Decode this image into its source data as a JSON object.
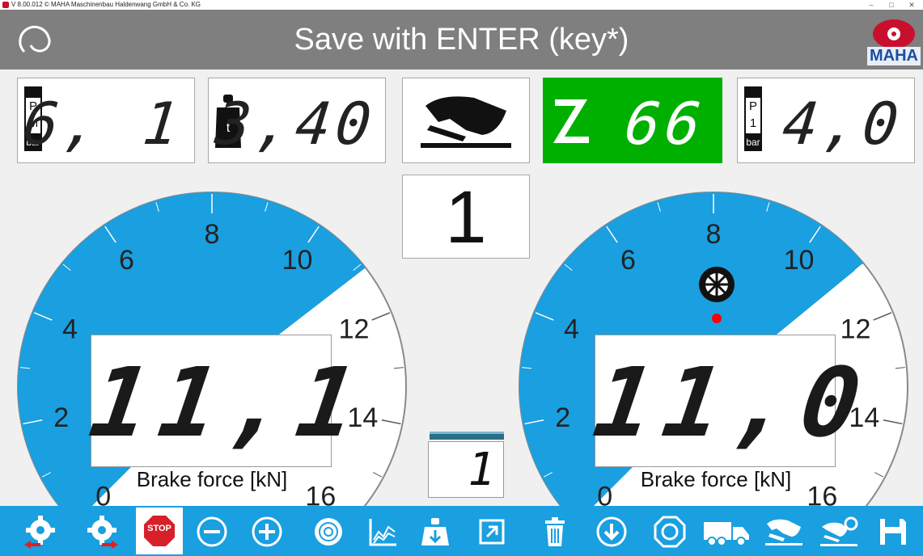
{
  "window": {
    "title": "V 8.00.012  © MAHA Maschinenbau Haldenwang GmbH & Co. KG",
    "minimize": "–",
    "maximize": "□",
    "close": "✕"
  },
  "header": {
    "title": "Save with ENTER (key*)",
    "brand": "MAHA"
  },
  "panels": {
    "pm": {
      "label_top": "P",
      "label_mid": "M",
      "unit": "bar",
      "value": "6, 1"
    },
    "weight": {
      "unit": "t",
      "value": "3,40"
    },
    "z": {
      "letter": "Z",
      "unit": "%",
      "value": "66"
    },
    "p1": {
      "label_top": "P",
      "label_mid": "1",
      "unit": "bar",
      "value": "4,0"
    }
  },
  "axle_number": "1",
  "small_readout": "1",
  "gauge_left": {
    "ticks": [
      "0",
      "2",
      "4",
      "6",
      "8",
      "10",
      "12",
      "14",
      "16"
    ],
    "value": "11,1",
    "label": "Brake force [kN]",
    "reading": 11.1
  },
  "gauge_right": {
    "ticks": [
      "0",
      "2",
      "4",
      "6",
      "8",
      "10",
      "12",
      "14",
      "16"
    ],
    "value": "11,0",
    "label": "Brake force [kN]",
    "reading": 11.0
  },
  "toolbar": {
    "stop_label": "STOP"
  },
  "colors": {
    "accent": "#1a9fe0",
    "header": "#7f7f7f",
    "z_green": "#00b000",
    "stop_red": "#d8202a",
    "alert_red": "#ff0000"
  }
}
